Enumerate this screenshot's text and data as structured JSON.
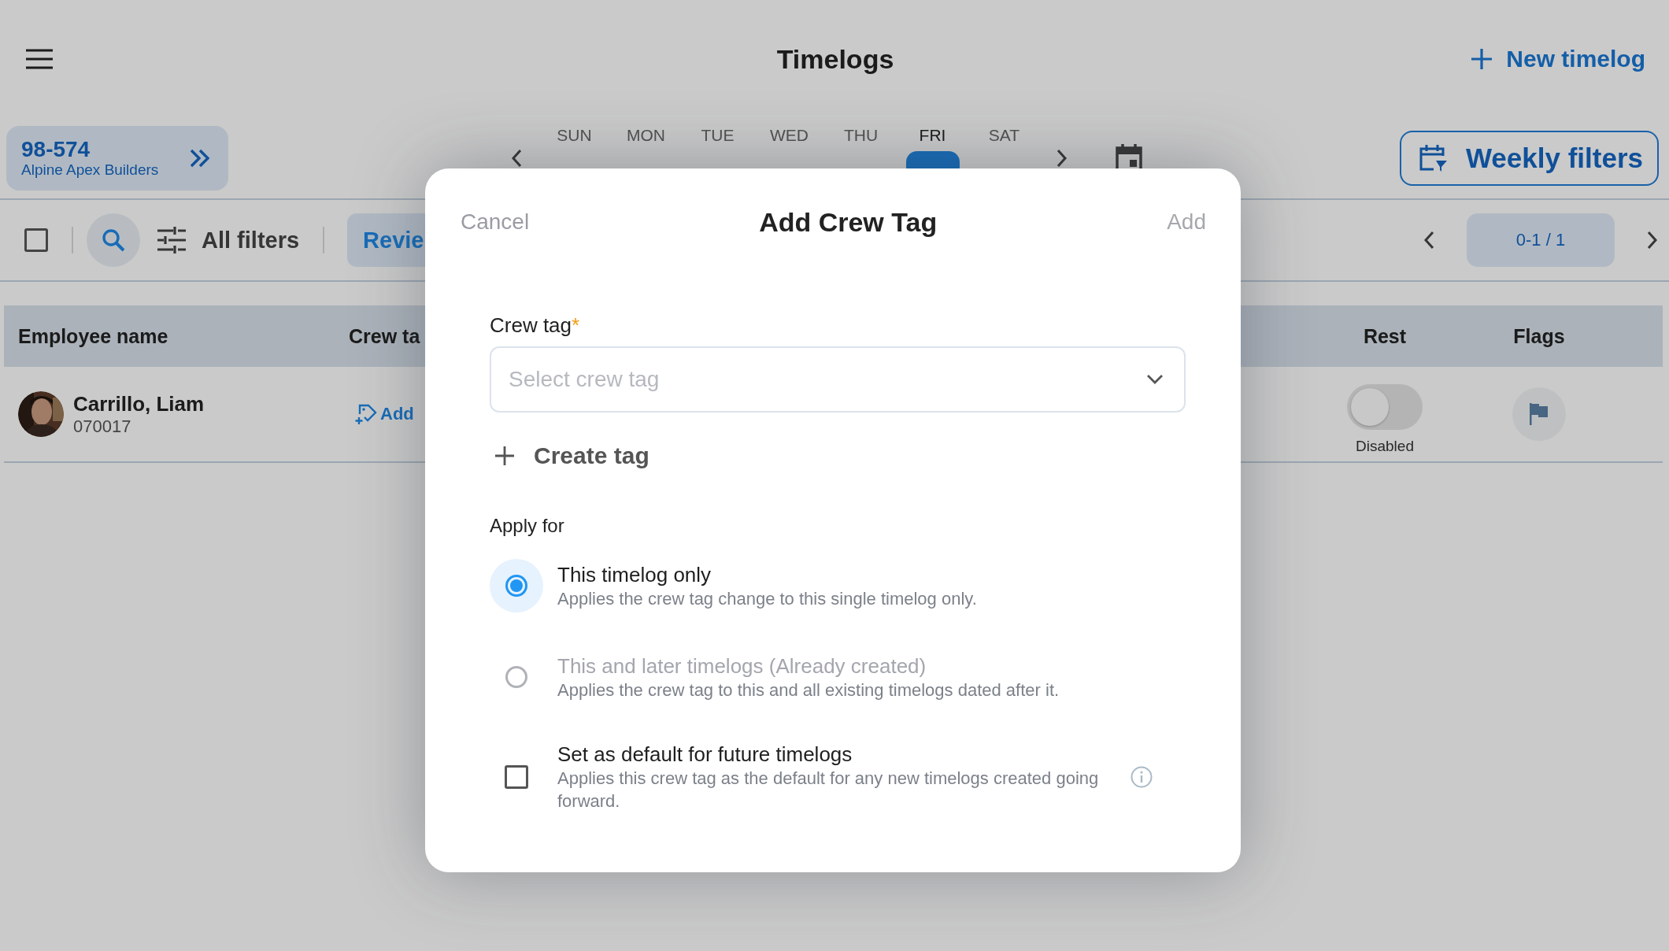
{
  "header": {
    "title": "Timelogs",
    "new_button": "New timelog"
  },
  "job": {
    "number": "98-574",
    "company": "Alpine Apex Builders"
  },
  "week": {
    "days": [
      {
        "name": "SUN",
        "selected": false
      },
      {
        "name": "MON",
        "selected": false
      },
      {
        "name": "TUE",
        "selected": false
      },
      {
        "name": "WED",
        "selected": false
      },
      {
        "name": "THU",
        "selected": false
      },
      {
        "name": "FRI",
        "selected": true
      },
      {
        "name": "SAT",
        "selected": false
      }
    ]
  },
  "weekly_filters": "Weekly filters",
  "toolbar": {
    "select_all_checked": false,
    "all_filters": "All filters",
    "review_tab": "Revie",
    "pagination": "0-1 / 1"
  },
  "table": {
    "columns": [
      "Employee name",
      "Crew ta",
      "Rest",
      "Flags"
    ],
    "rows": [
      {
        "name": "Carrillo, Liam",
        "id": "070017",
        "crew_tag_action": "Add",
        "rest_on": false,
        "rest_label": "Disabled"
      }
    ]
  },
  "dialog": {
    "cancel": "Cancel",
    "title": "Add Crew Tag",
    "add": "Add",
    "add_disabled": true,
    "field": {
      "label": "Crew tag",
      "required_mark": "*",
      "placeholder": "Select crew tag"
    },
    "create_tag": "Create tag",
    "apply_label": "Apply for",
    "options": [
      {
        "kind": "radio",
        "title": "This timelog only",
        "description": "Applies the crew tag change to this single timelog only.",
        "selected": true,
        "disabled": false
      },
      {
        "kind": "radio",
        "title": "This and later timelogs (Already created)",
        "description": "Applies the crew tag to this and all existing timelogs dated after it.",
        "selected": false,
        "disabled": true
      },
      {
        "kind": "checkbox",
        "title": "Set as default for future timelogs",
        "description": "Applies this crew tag as the default for any new timelogs created going forward.",
        "checked": false,
        "disabled": false
      }
    ]
  }
}
